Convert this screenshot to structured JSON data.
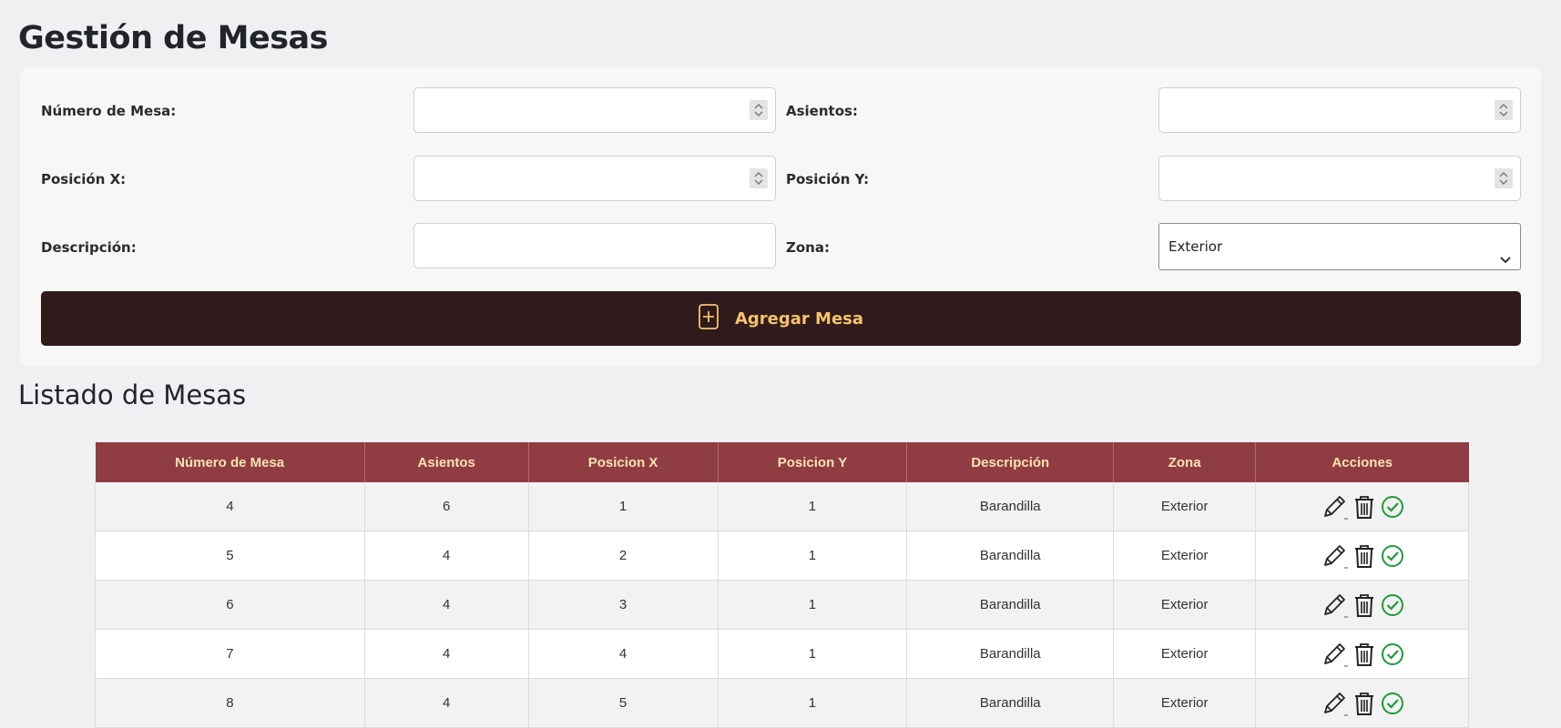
{
  "page": {
    "title": "Gestión de Mesas",
    "list_title": "Listado de Mesas"
  },
  "form": {
    "numero_label": "Número de Mesa:",
    "numero_value": "",
    "asientos_label": "Asientos:",
    "asientos_value": "",
    "posx_label": "Posición X:",
    "posx_value": "",
    "posy_label": "Posición Y:",
    "posy_value": "",
    "descripcion_label": "Descripción:",
    "descripcion_value": "",
    "zona_label": "Zona:",
    "zona_selected": "Exterior",
    "submit_label": "Agregar Mesa"
  },
  "table": {
    "headers": [
      "Número de Mesa",
      "Asientos",
      "Posicion X",
      "Posicion Y",
      "Descripción",
      "Zona",
      "Acciones"
    ],
    "rows": [
      [
        "4",
        "6",
        "1",
        "1",
        "Barandilla",
        "Exterior"
      ],
      [
        "5",
        "4",
        "2",
        "1",
        "Barandilla",
        "Exterior"
      ],
      [
        "6",
        "4",
        "3",
        "1",
        "Barandilla",
        "Exterior"
      ],
      [
        "7",
        "4",
        "4",
        "1",
        "Barandilla",
        "Exterior"
      ],
      [
        "8",
        "4",
        "5",
        "1",
        "Barandilla",
        "Exterior"
      ]
    ]
  },
  "colors": {
    "button_bg": "#2f1b1c",
    "button_text": "#f5c36b",
    "header_bg": "#8f3c43",
    "header_text": "#fde3b0",
    "check_green": "#1f9a3a"
  },
  "icons": {
    "edit": "pencil-icon",
    "delete": "trash-icon",
    "confirm": "check-circle-icon",
    "add": "plus-square-icon"
  }
}
